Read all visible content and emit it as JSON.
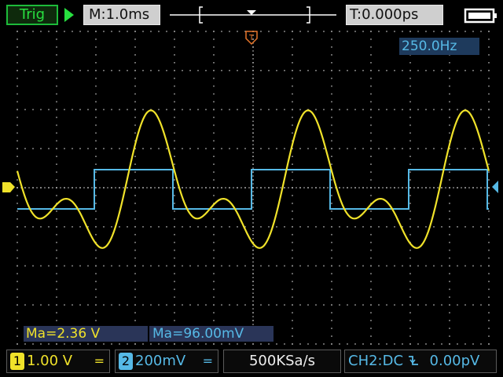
{
  "top": {
    "trigger_label": "Trig",
    "timebase": "M:1.0ms",
    "trigger_offset": "T:0.000ps",
    "run_icon": "play-triangle-icon",
    "battery_icon": "battery-icon",
    "trigger_pos_icon": "trigger-position-marker-icon"
  },
  "screen": {
    "frequency": "250.0Hz",
    "trigger_marker_label": "T",
    "ch1_measure": "Ma=2.36  V",
    "ch2_measure": "Ma=96.00mV"
  },
  "bottom": {
    "ch1_number": "1",
    "ch1_scale": "1.00  V",
    "ch1_coupling": "=",
    "ch2_number": "2",
    "ch2_scale": "200mV",
    "ch2_coupling": "=",
    "sample_rate": "500KSa/s",
    "trigger_info": "CH2:DC",
    "trigger_edge_icon": "falling-edge-icon",
    "trigger_level": "0.00pV"
  },
  "colors": {
    "ch1": "#f0e22a",
    "ch2": "#56b9e6",
    "trigger_marker": "#e8762a",
    "trig_green": "#28e040"
  }
}
